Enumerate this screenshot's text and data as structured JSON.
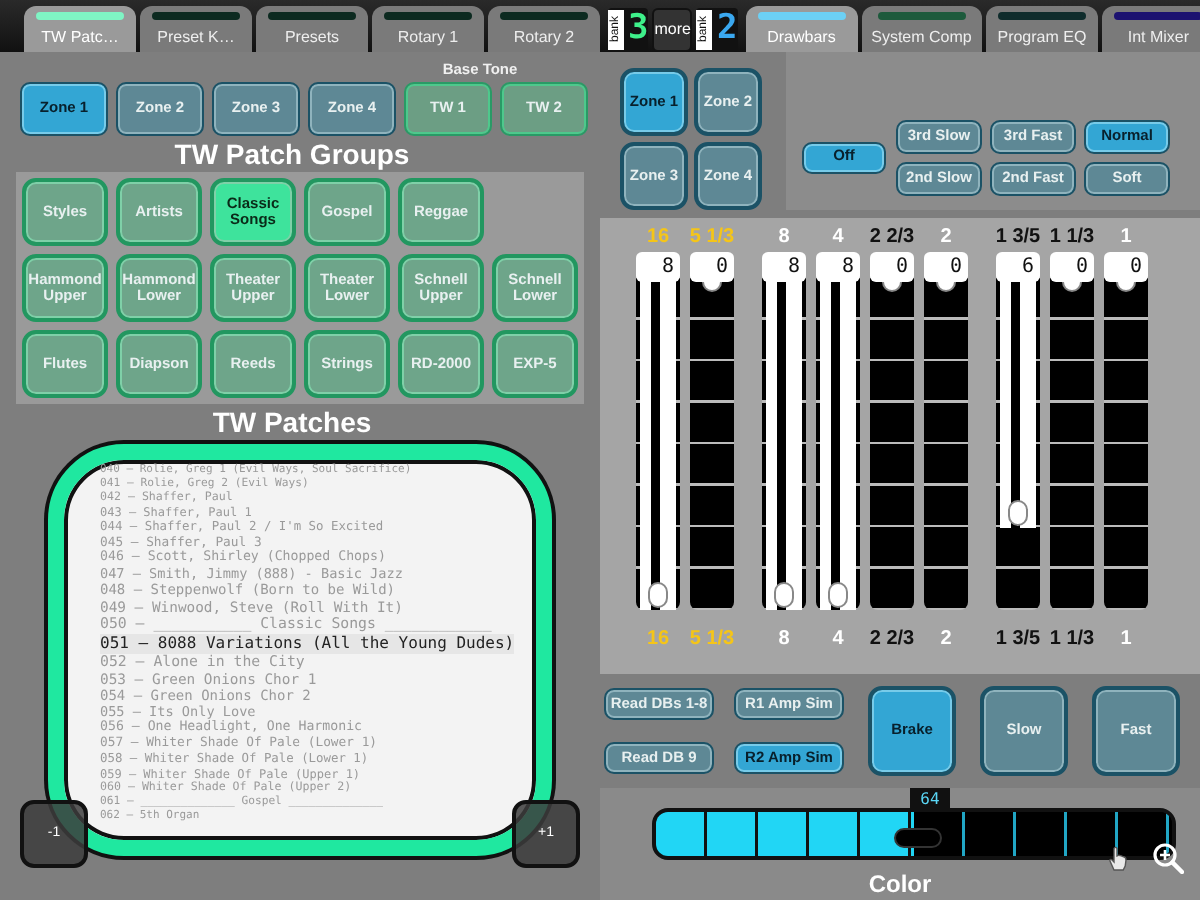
{
  "top_bar": {
    "tabs_left": [
      {
        "label": "TW Patc…",
        "selected": true,
        "color": "#7ff5c4"
      },
      {
        "label": "Preset K…",
        "selected": false,
        "color": "#0c2a20"
      },
      {
        "label": "Presets",
        "selected": false,
        "color": "#0c2a20"
      },
      {
        "label": "Rotary 1",
        "selected": false,
        "color": "#0c2a20"
      },
      {
        "label": "Rotary 2",
        "selected": false,
        "color": "#0c2a20"
      }
    ],
    "bank_left": {
      "label": "bank",
      "digit": "3",
      "color": "#3ef08a"
    },
    "more_button": "more",
    "bank_right": {
      "label": "bank",
      "digit": "2",
      "color": "#3aa8f0"
    },
    "tabs_right": [
      {
        "label": "Drawbars",
        "selected": true,
        "color": "#6cd0f5"
      },
      {
        "label": "System Comp",
        "selected": false,
        "color": "#1d5a3c"
      },
      {
        "label": "Program EQ",
        "selected": false,
        "color": "#0f2c2c"
      },
      {
        "label": "Int Mixer",
        "selected": false,
        "color": "#1c1270"
      }
    ]
  },
  "left": {
    "base_tone_label": "Base Tone",
    "zone_buttons": [
      {
        "label": "Zone 1",
        "kind": "zone",
        "selected": true
      },
      {
        "label": "Zone 2",
        "kind": "zone",
        "selected": false
      },
      {
        "label": "Zone 3",
        "kind": "zone",
        "selected": false
      },
      {
        "label": "Zone 4",
        "kind": "zone",
        "selected": false
      },
      {
        "label": "TW 1",
        "kind": "tone",
        "selected": false
      },
      {
        "label": "TW 2",
        "kind": "tone",
        "selected": false
      }
    ],
    "patch_groups_title": "TW Patch Groups",
    "patch_group_rows": [
      [
        {
          "label": "Styles",
          "selected": false
        },
        {
          "label": "Artists",
          "selected": false
        },
        {
          "label": "Classic Songs",
          "selected": true
        },
        {
          "label": "Gospel",
          "selected": false
        },
        {
          "label": "Reggae",
          "selected": false
        }
      ],
      [
        {
          "label": "Hammond Upper",
          "selected": false
        },
        {
          "label": "Hammond Lower",
          "selected": false
        },
        {
          "label": "Theater Upper",
          "selected": false
        },
        {
          "label": "Theater Lower",
          "selected": false
        },
        {
          "label": "Schnell Upper",
          "selected": false
        },
        {
          "label": "Schnell Lower",
          "selected": false
        }
      ],
      [
        {
          "label": "Flutes",
          "selected": false
        },
        {
          "label": "Diapson",
          "selected": false
        },
        {
          "label": "Reeds",
          "selected": false
        },
        {
          "label": "Strings",
          "selected": false
        },
        {
          "label": "RD-2000",
          "selected": false
        },
        {
          "label": "EXP-5",
          "selected": false
        }
      ]
    ],
    "patches_title": "TW Patches",
    "patch_list": [
      {
        "text": "040 – Rolie, Greg 1 (Evil Ways, Soul Sacrifice)",
        "selected": false
      },
      {
        "text": "041 – Rolie, Greg 2 (Evil Ways)",
        "selected": false
      },
      {
        "text": "042 – Shaffer, Paul",
        "selected": false
      },
      {
        "text": "043 – Shaffer, Paul 1",
        "selected": false
      },
      {
        "text": "044 – Shaffer, Paul 2 / I'm So Excited",
        "selected": false
      },
      {
        "text": "045 – Shaffer, Paul 3",
        "selected": false
      },
      {
        "text": "046 – Scott, Shirley (Chopped Chops)",
        "selected": false
      },
      {
        "text": "047 – Smith, Jimmy (888) - Basic Jazz",
        "selected": false
      },
      {
        "text": "048 – Steppenwolf (Born to be Wild)",
        "selected": false
      },
      {
        "text": "049 – Winwood, Steve (Roll With It)",
        "selected": false
      },
      {
        "text": "050 – ___________ Classic Songs ____________",
        "selected": false
      },
      {
        "text": "051 – 8088 Variations (All the Young Dudes)",
        "selected": true
      },
      {
        "text": "052 – Alone in the City",
        "selected": false
      },
      {
        "text": "053 – Green Onions Chor 1",
        "selected": false
      },
      {
        "text": "054 – Green Onions Chor 2",
        "selected": false
      },
      {
        "text": "055 – Its Only Love",
        "selected": false
      },
      {
        "text": "056 – One Headlight, One Harmonic",
        "selected": false
      },
      {
        "text": "057 – Whiter Shade Of Pale (Lower 1)",
        "selected": false
      },
      {
        "text": "058 – Whiter Shade Of Pale (Lower 1)",
        "selected": false
      },
      {
        "text": "059 – Whiter Shade Of Pale (Upper 1)",
        "selected": false
      },
      {
        "text": "060 – Whiter Shade Of Pale (Upper 2)",
        "selected": false
      },
      {
        "text": "061 – ______________ Gospel ______________",
        "selected": false
      },
      {
        "text": "062 – 5th Organ",
        "selected": false
      }
    ],
    "prev_button": "-1",
    "next_button": "+1"
  },
  "right": {
    "zones": [
      {
        "label": "Zone 1",
        "selected": true
      },
      {
        "label": "Zone 2",
        "selected": false
      },
      {
        "label": "Zone 3",
        "selected": false
      },
      {
        "label": "Zone 4",
        "selected": false
      }
    ],
    "vibrato_switch": {
      "label": "Off",
      "selected": true
    },
    "vibrato_modes": [
      {
        "label": "3rd Slow",
        "selected": false
      },
      {
        "label": "3rd Fast",
        "selected": false
      },
      {
        "label": "Normal",
        "selected": true
      },
      {
        "label": "2nd Slow",
        "selected": false
      },
      {
        "label": "2nd Fast",
        "selected": false
      },
      {
        "label": "Soft",
        "selected": false
      }
    ],
    "drawbar_groups": [
      {
        "drawbars": [
          {
            "label": "16",
            "value": "8",
            "level": 1,
            "color": "#f5c518",
            "bottom_label": "16"
          },
          {
            "label": "5 1/3",
            "value": "0",
            "level": 0,
            "color": "#f5c518",
            "bottom_label": "5 1/3"
          }
        ]
      },
      {
        "drawbars": [
          {
            "label": "8",
            "value": "8",
            "level": 1,
            "color": "#ffffff",
            "bottom_label": "8"
          },
          {
            "label": "4",
            "value": "8",
            "level": 1,
            "color": "#ffffff",
            "bottom_label": "4"
          },
          {
            "label": "2 2/3",
            "value": "0",
            "level": 0,
            "color": "#111111",
            "bottom_label": "2 2/3"
          },
          {
            "label": "2",
            "value": "0",
            "level": 0,
            "color": "#ffffff",
            "bottom_label": "2"
          }
        ]
      },
      {
        "drawbars": [
          {
            "label": "1 3/5",
            "value": "6",
            "level": 0.75,
            "color": "#111111",
            "bottom_label": "1 3/5"
          },
          {
            "label": "1 1/3",
            "value": "0",
            "level": 0,
            "color": "#111111",
            "bottom_label": "1 1/3"
          },
          {
            "label": "1",
            "value": "0",
            "level": 0,
            "color": "#ffffff",
            "bottom_label": "1"
          }
        ]
      }
    ],
    "amp_buttons": [
      {
        "label": "Read DBs 1-8",
        "selected": false
      },
      {
        "label": "R1 Amp Sim",
        "selected": false
      },
      {
        "label": "Read DB 9",
        "selected": false
      },
      {
        "label": "R2 Amp Sim",
        "selected": true
      }
    ],
    "rotary_buttons": [
      {
        "label": "Brake",
        "selected": true
      },
      {
        "label": "Slow",
        "selected": false
      },
      {
        "label": "Fast",
        "selected": false
      }
    ],
    "color_slider": {
      "value": "64",
      "level": 0.5,
      "label": "Color"
    }
  }
}
